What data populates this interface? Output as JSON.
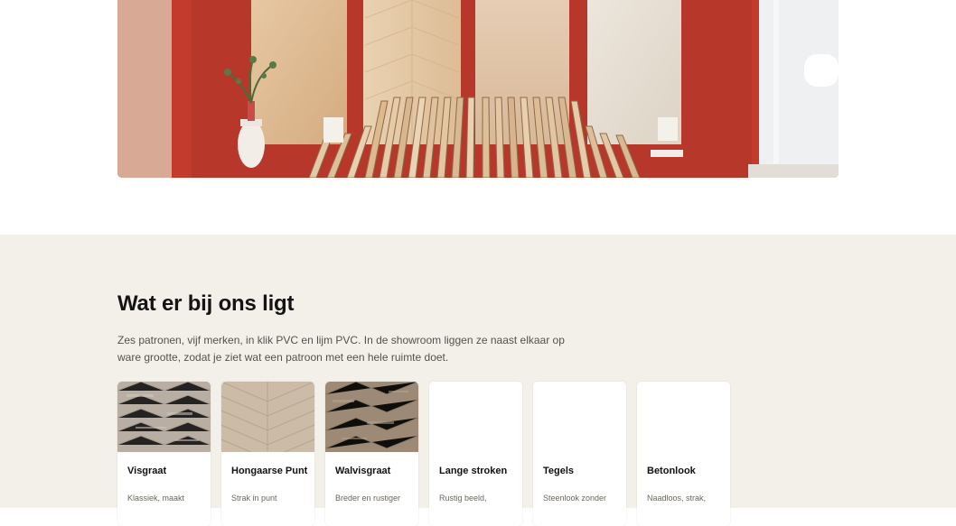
{
  "hero": {
    "image_alt": "Showroom met houten vloerpanelen tegen een rode wand"
  },
  "section": {
    "title": "Wat er bij ons ligt",
    "description": "Zes patronen, vijf merken, in klik PVC en lijm PVC. In de showroom liggen ze naast elkaar op ware grootte, zodat je ziet wat een patroon met een hele ruimte doet."
  },
  "cards": [
    {
      "title": "Visgraat",
      "text": "Klassiek, maakt",
      "image": "visgraat-texture"
    },
    {
      "title": "Hongaarse Punt",
      "text": "Strak in punt",
      "image": "hongaarse-punt-texture"
    },
    {
      "title": "Walvisgraat",
      "text": "Breder en rustiger",
      "image": "walvisgraat-texture"
    },
    {
      "title": "Lange stroken",
      "text": "Rustig beeld,",
      "image": ""
    },
    {
      "title": "Tegels",
      "text": "Steenlook zonder",
      "image": ""
    },
    {
      "title": "Betonlook",
      "text": "Naadloos, strak,",
      "image": ""
    }
  ],
  "colors": {
    "section_bg": "#f3f0ea",
    "wall_red": "#b8392c",
    "text_dark": "#141414"
  }
}
